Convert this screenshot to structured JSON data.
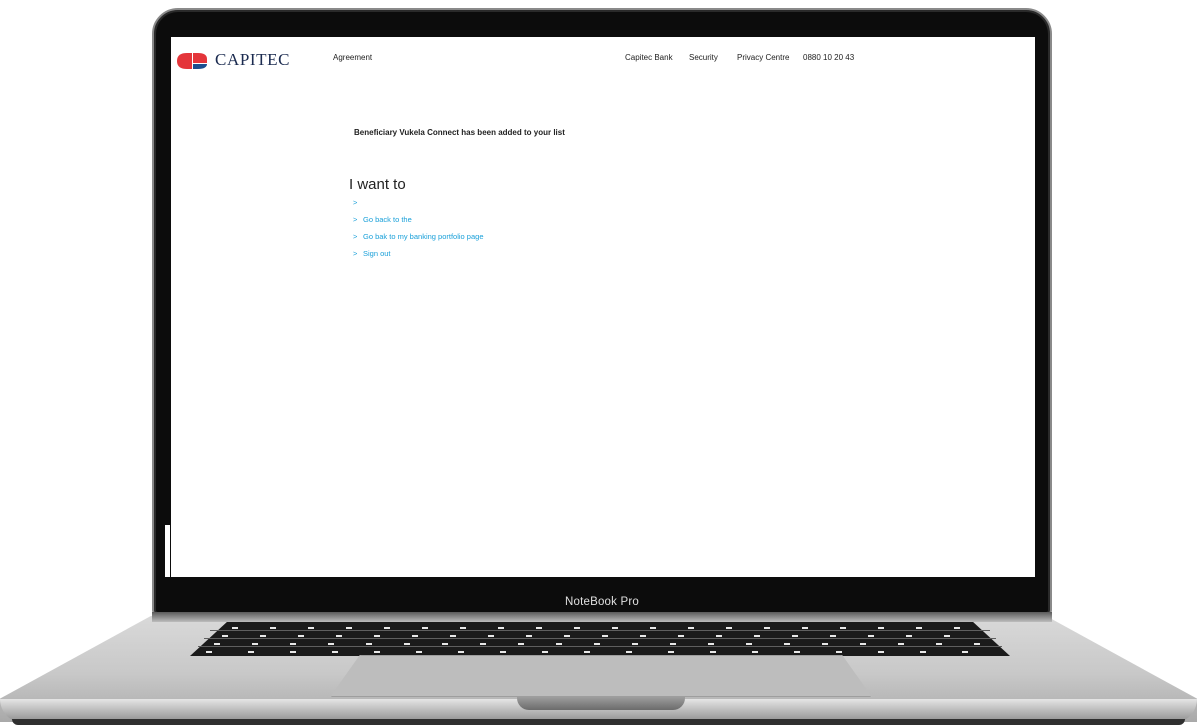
{
  "device": {
    "label": "NoteBook Pro"
  },
  "brand": {
    "name": "CAPITEC",
    "colors": {
      "logo_red": "#e4353a",
      "logo_blue": "#1a4e8f",
      "link": "#1aa0d9",
      "text": "#222222"
    }
  },
  "nav": {
    "left": "Agreement",
    "right": [
      "Capitec Bank",
      "Security",
      "Privacy Centre",
      "0880 10 20 43"
    ]
  },
  "content": {
    "message": "Beneficiary Vukela Connect has been added to your list",
    "heading": "I want to",
    "links": [
      {
        "chevron": ">",
        "label": ""
      },
      {
        "chevron": ">",
        "label": "Go back to the"
      },
      {
        "chevron": ">",
        "label": "Go bak to my banking portfolio page"
      },
      {
        "chevron": ">",
        "label": "Sign out"
      }
    ]
  }
}
